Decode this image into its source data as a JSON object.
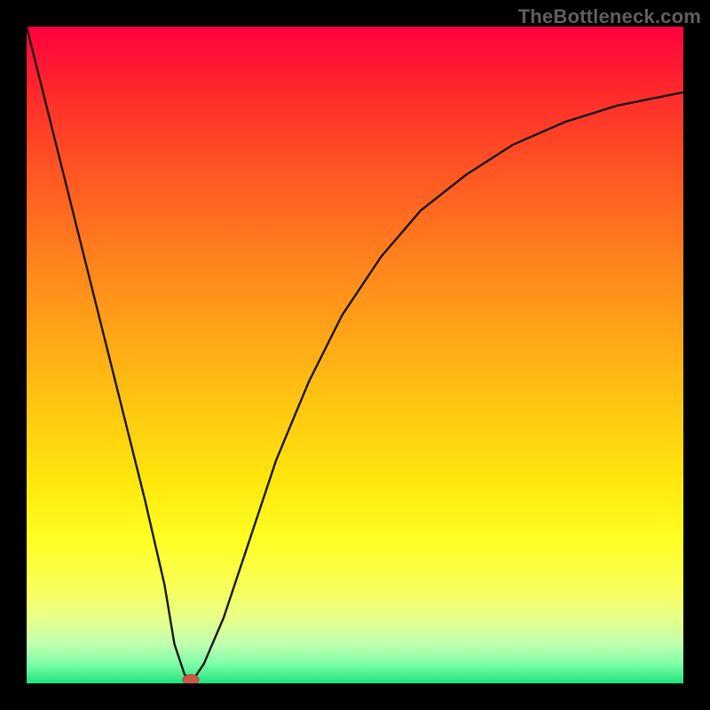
{
  "watermark": "TheBottleneck.com",
  "chart_data": {
    "type": "line",
    "title": "",
    "xlabel": "",
    "ylabel": "",
    "xlim": [
      0,
      100
    ],
    "ylim": [
      0,
      100
    ],
    "series": [
      {
        "name": "curve",
        "x": [
          0,
          5,
          10,
          15,
          18,
          21,
          22.5,
          24,
          25,
          27,
          30,
          34,
          38,
          43,
          48,
          54,
          60,
          67,
          74,
          82,
          90,
          100
        ],
        "values": [
          100,
          80,
          60,
          40,
          28,
          15,
          6,
          1.5,
          0,
          3,
          10,
          22,
          34,
          46,
          56,
          65,
          72,
          77.5,
          82,
          85.5,
          88,
          90
        ]
      }
    ],
    "marker": {
      "x": 25,
      "y": 0,
      "color": "#c85a4a"
    }
  },
  "gradient": {
    "top": "#ff0040",
    "mid": "#ffe60c",
    "bottom": "#20e27a"
  }
}
